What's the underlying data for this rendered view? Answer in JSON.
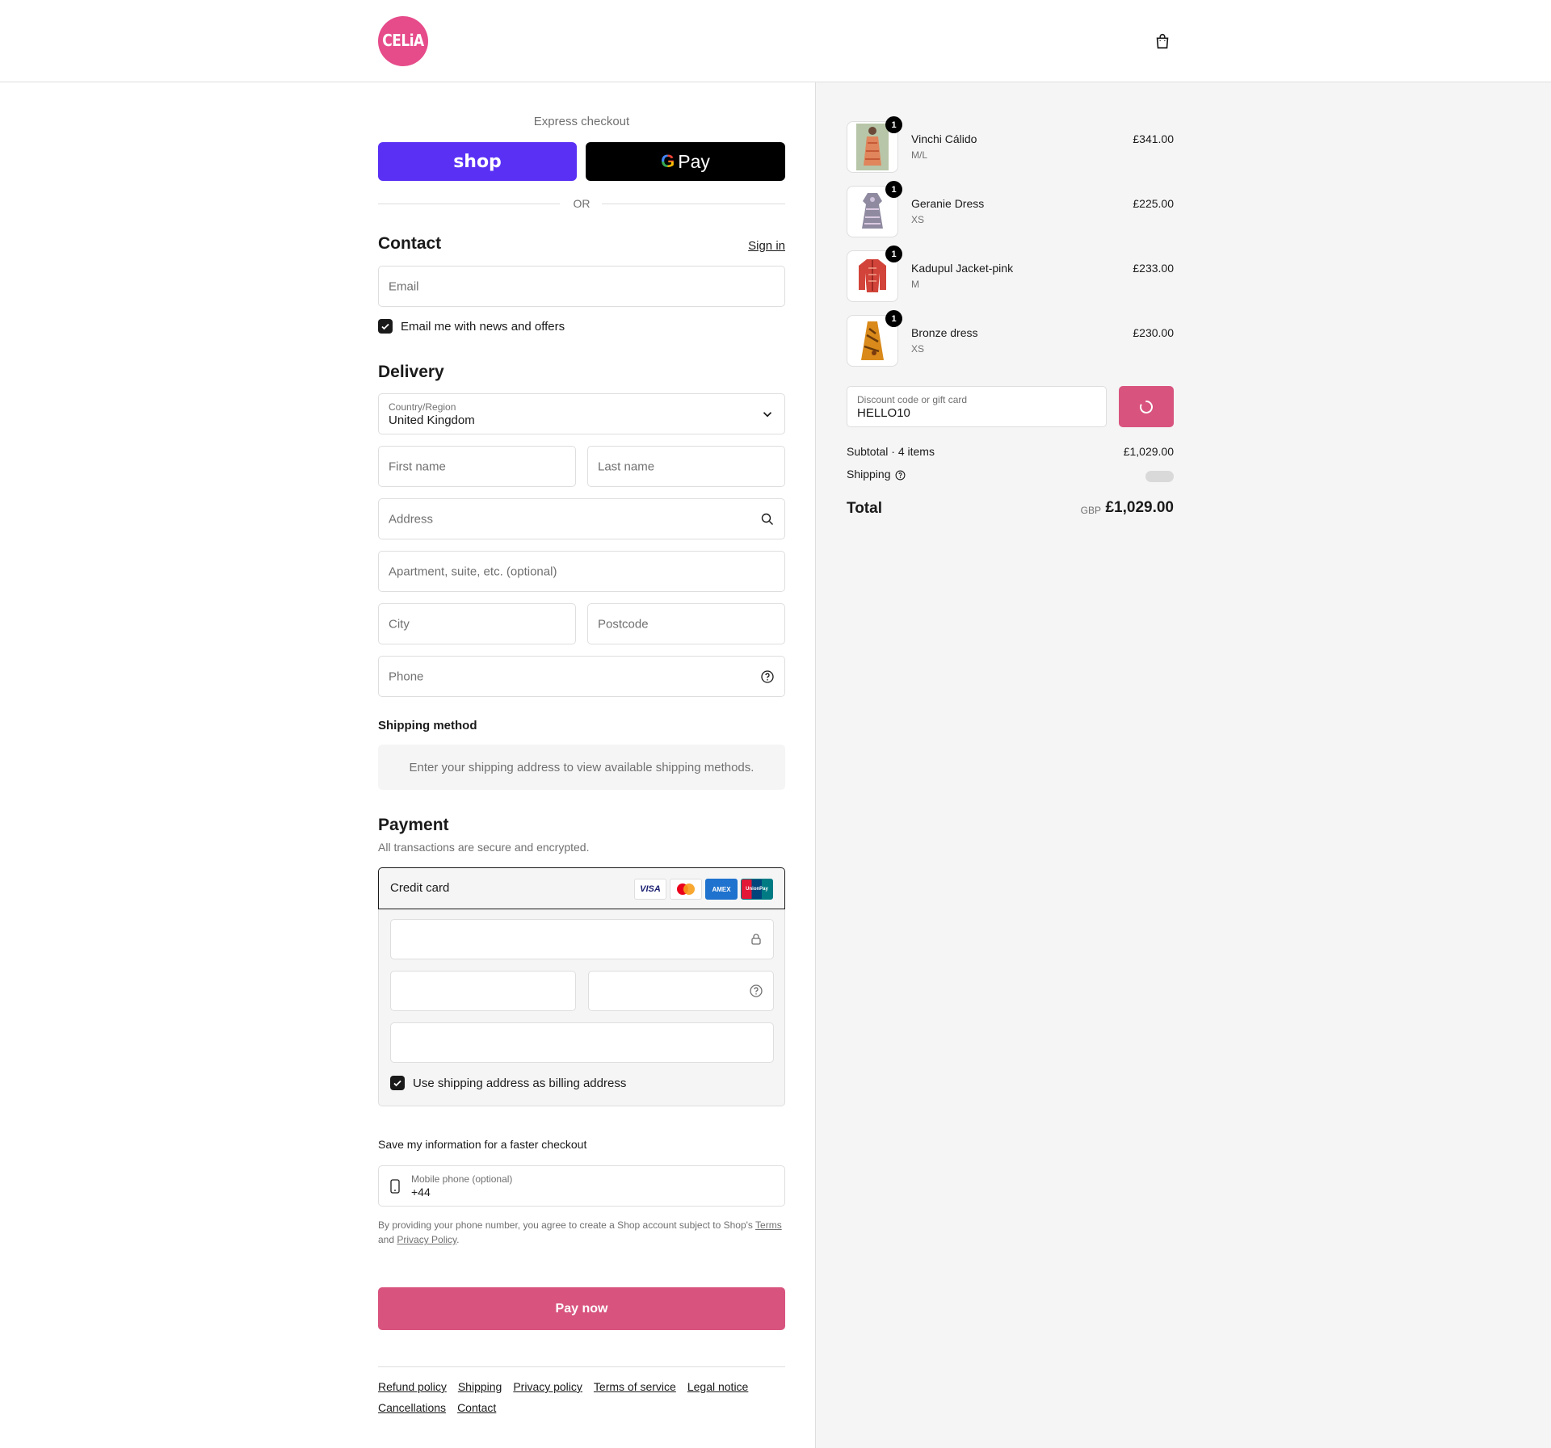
{
  "brand": {
    "logo_text": "CELiA",
    "accent": "#e64b8a",
    "button_color": "#d8547f"
  },
  "header": {
    "cart_icon": "shopping-bag-icon"
  },
  "express": {
    "title": "Express checkout",
    "shop_label": "shop",
    "gpay_g": "G",
    "gpay_label": "Pay",
    "or_label": "OR"
  },
  "contact": {
    "title": "Contact",
    "sign_in": "Sign in",
    "email_placeholder": "Email",
    "newsletter_label": "Email me with news and offers",
    "newsletter_checked": true
  },
  "delivery": {
    "title": "Delivery",
    "country_label": "Country/Region",
    "country_value": "United Kingdom",
    "first_name_placeholder": "First name",
    "last_name_placeholder": "Last name",
    "address_placeholder": "Address",
    "apartment_placeholder": "Apartment, suite, etc. (optional)",
    "city_placeholder": "City",
    "postcode_placeholder": "Postcode",
    "phone_placeholder": "Phone"
  },
  "shipping_method": {
    "title": "Shipping method",
    "message": "Enter your shipping address to view available shipping methods."
  },
  "payment": {
    "title": "Payment",
    "subtitle": "All transactions are secure and encrypted.",
    "method_label": "Credit card",
    "card_brands": [
      "VISA",
      "Mastercard",
      "AMEX",
      "UnionPay"
    ],
    "billing_same_label": "Use shipping address as billing address",
    "billing_same_checked": true
  },
  "save_info": {
    "title": "Save my information for a faster checkout",
    "mobile_label": "Mobile phone (optional)",
    "mobile_value": "+44",
    "legal_prefix": "By providing your phone number, you agree to create a Shop account subject to Shop's ",
    "legal_terms": "Terms",
    "legal_and": "and ",
    "legal_privacy": "Privacy Policy",
    "legal_suffix": "."
  },
  "pay_now_label": "Pay now",
  "footer_links": [
    "Refund policy",
    "Shipping",
    "Privacy policy",
    "Terms of service",
    "Legal notice",
    "Cancellations",
    "Contact"
  ],
  "order": {
    "items": [
      {
        "name": "Vinchi Cálido",
        "variant": "M/L",
        "price": "£341.00",
        "qty": "1"
      },
      {
        "name": "Geranie Dress",
        "variant": "XS",
        "price": "£225.00",
        "qty": "1"
      },
      {
        "name": "Kadupul Jacket-pink",
        "variant": "M",
        "price": "£233.00",
        "qty": "1"
      },
      {
        "name": "Bronze dress",
        "variant": "XS",
        "price": "£230.00",
        "qty": "1"
      }
    ],
    "discount_label": "Discount code or gift card",
    "discount_value": "HELLO10",
    "subtotal_label": "Subtotal · 4 items",
    "subtotal_value": "£1,029.00",
    "shipping_label": "Shipping",
    "total_label": "Total",
    "total_currency": "GBP",
    "total_value": "£1,029.00"
  }
}
